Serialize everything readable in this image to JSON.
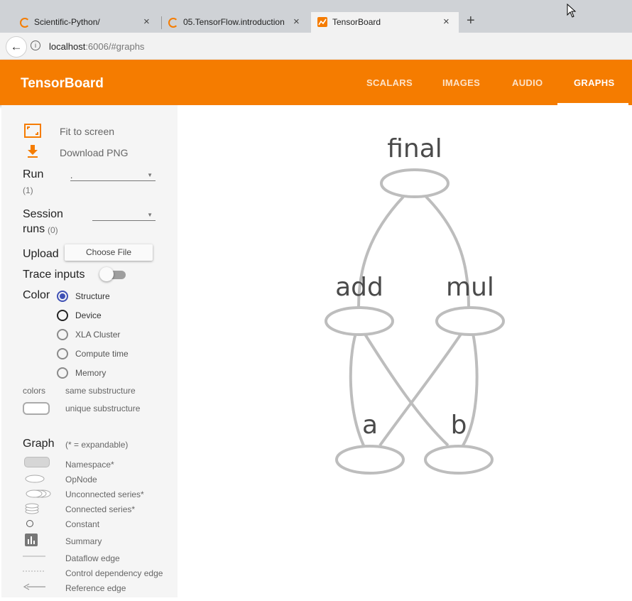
{
  "browser": {
    "tabs": [
      {
        "title": "Scientific-Python/",
        "close": "×"
      },
      {
        "title": "05.TensorFlow.introduction",
        "close": "×"
      },
      {
        "title": "TensorBoard",
        "close": "×"
      }
    ],
    "new_tab": "+",
    "url_host": "localhost",
    "url_rest": ":6006/#graphs",
    "back": "←",
    "info": "i"
  },
  "header": {
    "title": "TensorBoard",
    "nav": [
      "SCALARS",
      "IMAGES",
      "AUDIO",
      "GRAPHS"
    ],
    "active": "GRAPHS",
    "accent": "#f57c00"
  },
  "sidebar": {
    "fit_to_screen": "Fit to screen",
    "download_png": "Download PNG",
    "run_label": "Run",
    "run_count": "(1)",
    "run_value": ".",
    "session_label_1": "Session",
    "session_label_2": "runs",
    "session_count": "(0)",
    "upload_label": "Upload",
    "choose_file": "Choose File",
    "trace_inputs": "Trace inputs",
    "color_label": "Color",
    "color_options": [
      "Structure",
      "Device",
      "XLA Cluster",
      "Compute time",
      "Memory"
    ],
    "color_selected": "Structure",
    "colors_label": "colors",
    "same_substructure": "same substructure",
    "unique_substructure": "unique substructure",
    "graph_label": "Graph",
    "expandable_note": "(* = expandable)",
    "legend": [
      {
        "icon": "namespace-icon",
        "label": "Namespace*"
      },
      {
        "icon": "opnode-icon",
        "label": "OpNode"
      },
      {
        "icon": "unconnected-series-icon",
        "label": "Unconnected series*"
      },
      {
        "icon": "connected-series-icon",
        "label": "Connected series*"
      },
      {
        "icon": "constant-icon",
        "label": "Constant"
      },
      {
        "icon": "summary-icon",
        "label": "Summary"
      },
      {
        "icon": "dataflow-edge-icon",
        "label": "Dataflow edge"
      },
      {
        "icon": "control-dependency-edge-icon",
        "label": "Control dependency edge"
      },
      {
        "icon": "reference-edge-icon",
        "label": "Reference edge"
      }
    ]
  },
  "graph": {
    "nodes": [
      "final",
      "add",
      "mul",
      "a",
      "b"
    ],
    "edges": [
      [
        "a",
        "add"
      ],
      [
        "b",
        "add"
      ],
      [
        "a",
        "mul"
      ],
      [
        "b",
        "mul"
      ],
      [
        "add",
        "final"
      ],
      [
        "mul",
        "final"
      ]
    ],
    "edge_color": "#bdbdbd",
    "node_stroke": "#bdbdbd"
  }
}
